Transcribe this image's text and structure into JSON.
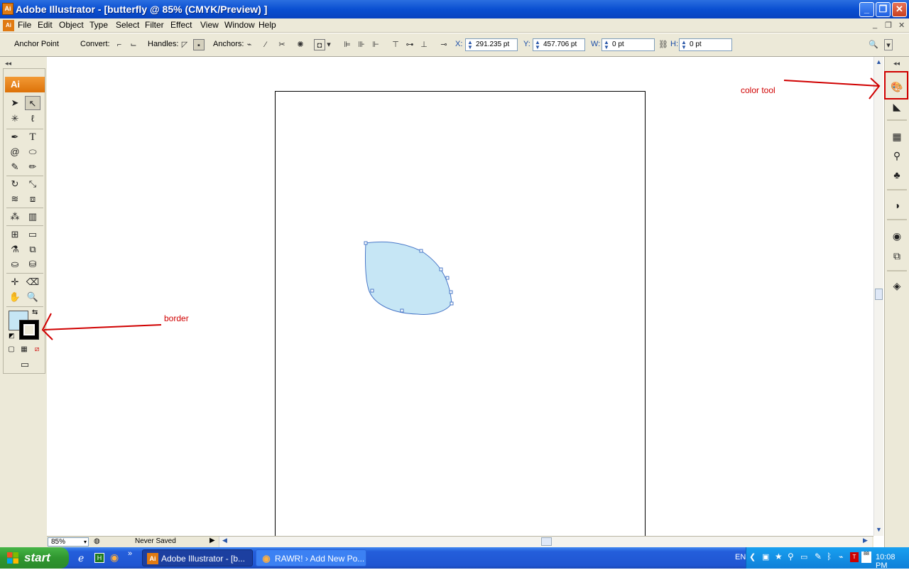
{
  "window": {
    "title": "Adobe Illustrator - [butterfly @ 85% (CMYK/Preview) ]",
    "app_icon": "Ai",
    "minimize": "_",
    "maximize": "❐",
    "close": "✕"
  },
  "menu": {
    "items": [
      "File",
      "Edit",
      "Object",
      "Type",
      "Select",
      "Filter",
      "Effect",
      "View",
      "Window",
      "Help"
    ]
  },
  "control_bar": {
    "selection_label": "Anchor Point",
    "convert_label": "Convert:",
    "handles_label": "Handles:",
    "anchors_label": "Anchors:",
    "x_label": "X:",
    "x_value": "291.235 pt",
    "y_label": "Y:",
    "y_value": "457.706 pt",
    "w_label": "W:",
    "w_value": "0 pt",
    "h_label": "H:",
    "h_value": "0 pt"
  },
  "tools": {
    "header": "Ai",
    "fill_color": "#c6e6f5",
    "stroke_color": "#000000"
  },
  "canvas": {
    "shape_fill": "#c6e6f5",
    "shape_stroke": "#4a78c8"
  },
  "status": {
    "zoom": "85%",
    "state": "Never Saved"
  },
  "annotations": {
    "color_tool": "color tool",
    "border": "border",
    "color": "#d00000"
  },
  "taskbar": {
    "start": "start",
    "tasks": [
      "Adobe Illustrator - [b...",
      "RAWR! › Add New Po..."
    ],
    "language": "EN",
    "clock": "10:08 PM"
  }
}
